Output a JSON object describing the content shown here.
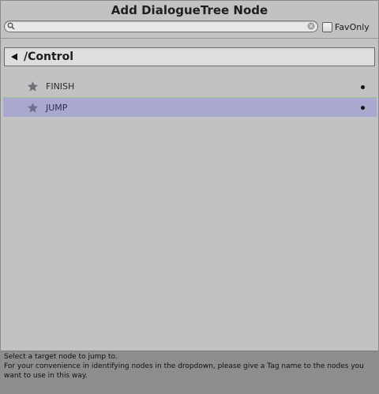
{
  "window": {
    "title": "Add DialogueTree Node"
  },
  "search": {
    "value": "",
    "placeholder": "",
    "search_icon": "magnifier-icon",
    "clear_icon": "clear-circle-icon"
  },
  "fav_only": {
    "label": "FavOnly",
    "checked": false
  },
  "category": {
    "back_icon": "left-triangle-icon",
    "title": "/Control"
  },
  "nodes": [
    {
      "label": "FINISH",
      "icon": "star-icon",
      "selected": false
    },
    {
      "label": "JUMP",
      "icon": "star-icon",
      "selected": true
    }
  ],
  "help": {
    "line1": "Select a target node to jump to.",
    "line2": "For your convenience in identifying nodes in the dropdown, please give a Tag name to the nodes you want to use in this way."
  },
  "colors": {
    "background": "#c2c2c2",
    "selected_row": "#a9a9d0",
    "help_panel": "#8d8d8d",
    "star": "#6f6f7a"
  }
}
